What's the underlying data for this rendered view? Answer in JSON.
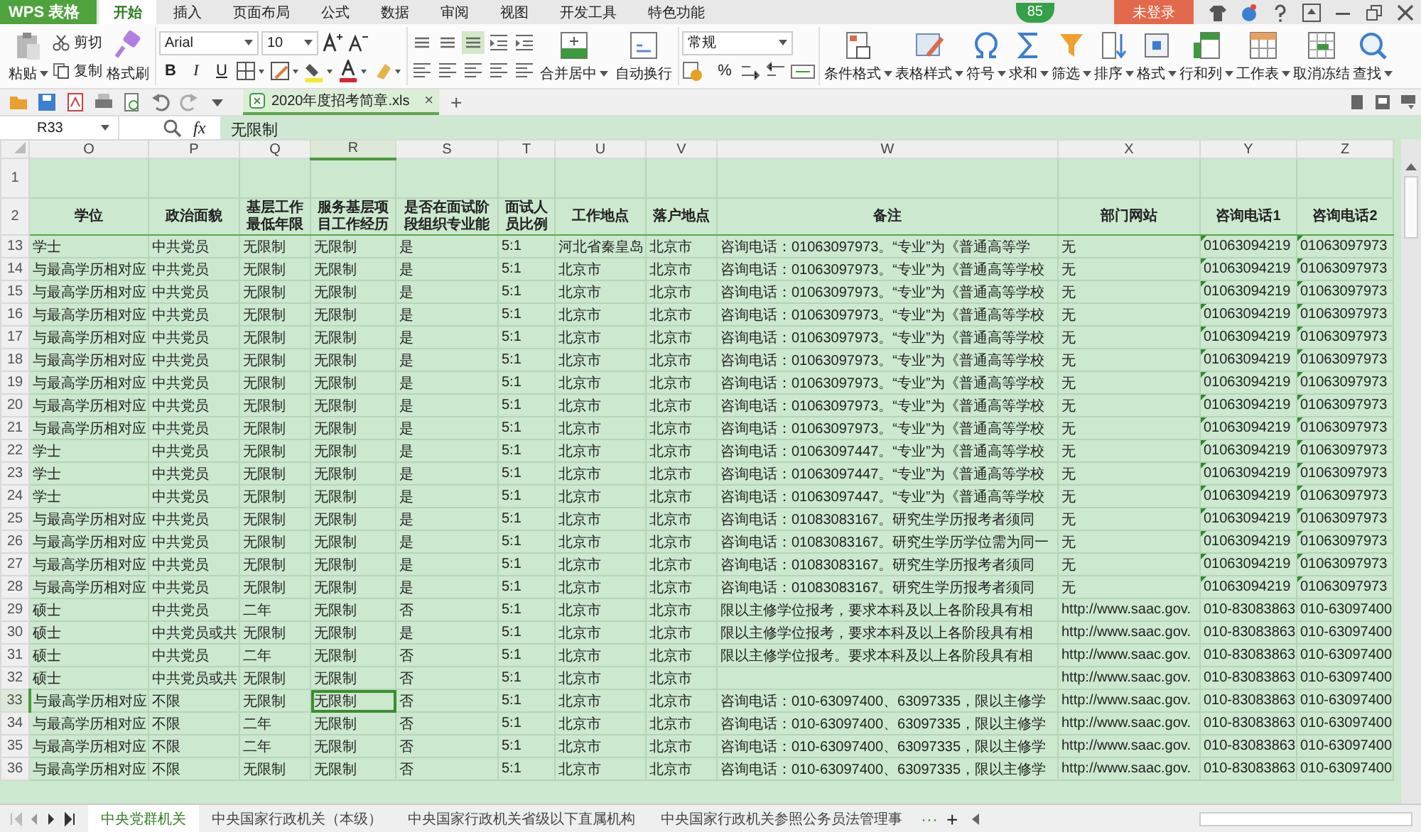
{
  "app": {
    "name": "WPS 表格",
    "badge": "85",
    "login": "未登录"
  },
  "menu_tabs": [
    {
      "label": "开始",
      "selected": true
    },
    {
      "label": "插入",
      "selected": false
    },
    {
      "label": "页面布局",
      "selected": false
    },
    {
      "label": "公式",
      "selected": false
    },
    {
      "label": "数据",
      "selected": false
    },
    {
      "label": "审阅",
      "selected": false
    },
    {
      "label": "视图",
      "selected": false
    },
    {
      "label": "开发工具",
      "selected": false
    },
    {
      "label": "特色功能",
      "selected": false
    }
  ],
  "ribbon": {
    "clipboard": {
      "paste": "粘贴",
      "cut": "剪切",
      "copy": "复制",
      "format_painter": "格式刷"
    },
    "font": {
      "name": "Arial",
      "size": "10",
      "bold": "B",
      "italic": "I",
      "underline": "U"
    },
    "alignment": {
      "merge": "合并居中",
      "wrap": "自动换行"
    },
    "number": {
      "format": "常规",
      "percent": "%"
    },
    "tools": [
      {
        "label": "条件格式",
        "kind": "conditional",
        "dropdown": true
      },
      {
        "label": "表格样式",
        "kind": "table-style",
        "dropdown": true
      },
      {
        "label": "符号",
        "kind": "symbol",
        "dropdown": true
      },
      {
        "label": "求和",
        "kind": "sum",
        "dropdown": true
      },
      {
        "label": "筛选",
        "kind": "filter",
        "dropdown": true
      },
      {
        "label": "排序",
        "kind": "sort",
        "dropdown": true
      },
      {
        "label": "格式",
        "kind": "format",
        "dropdown": true
      },
      {
        "label": "行和列",
        "kind": "rows-cols",
        "dropdown": true
      },
      {
        "label": "工作表",
        "kind": "sheet",
        "dropdown": true
      },
      {
        "label": "取消冻结",
        "kind": "freeze",
        "dropdown": false
      },
      {
        "label": "查找",
        "kind": "find",
        "dropdown": true
      }
    ]
  },
  "document_tab": {
    "title": "2020年度招考简章.xls",
    "close": "×",
    "add": "+"
  },
  "formula_bar": {
    "cell": "R33",
    "fx": "fx",
    "value": "无限制"
  },
  "columns": [
    {
      "letter": "O",
      "header": "学位",
      "selected": false
    },
    {
      "letter": "P",
      "header": "政治面貌",
      "selected": false
    },
    {
      "letter": "Q",
      "header": "基层工作最低年限",
      "selected": false
    },
    {
      "letter": "R",
      "header": "服务基层项目工作经历",
      "selected": true
    },
    {
      "letter": "S",
      "header": "是否在面试阶段组织专业能",
      "selected": false
    },
    {
      "letter": "T",
      "header": "面试人员比例",
      "selected": false
    },
    {
      "letter": "U",
      "header": "工作地点",
      "selected": false
    },
    {
      "letter": "V",
      "header": "落户地点",
      "selected": false
    },
    {
      "letter": "W",
      "header": "备注",
      "selected": false
    },
    {
      "letter": "X",
      "header": "部门网站",
      "selected": false
    },
    {
      "letter": "Y",
      "header": "咨询电话1",
      "selected": false
    },
    {
      "letter": "Z",
      "header": "咨询电话2",
      "selected": false
    }
  ],
  "top_rows": [
    "1",
    "2"
  ],
  "rows": [
    {
      "number": "13",
      "selected": false,
      "flagged": true,
      "cells": [
        "学士",
        "中共党员",
        "无限制",
        "无限制",
        "是",
        "5:1",
        "河北省秦皇岛",
        "北京市",
        "咨询电话：01063097973。“专业”为《普通高等学",
        "无",
        "01063094219",
        "01063097973"
      ]
    },
    {
      "number": "14",
      "selected": false,
      "flagged": true,
      "cells": [
        "与最高学历相对应",
        "中共党员",
        "无限制",
        "无限制",
        "是",
        "5:1",
        "北京市",
        "北京市",
        "咨询电话：01063097973。“专业”为《普通高等学校",
        "无",
        "01063094219",
        "01063097973"
      ]
    },
    {
      "number": "15",
      "selected": false,
      "flagged": true,
      "cells": [
        "与最高学历相对应",
        "中共党员",
        "无限制",
        "无限制",
        "是",
        "5:1",
        "北京市",
        "北京市",
        "咨询电话：01063097973。“专业”为《普通高等学校",
        "无",
        "01063094219",
        "01063097973"
      ]
    },
    {
      "number": "16",
      "selected": false,
      "flagged": true,
      "cells": [
        "与最高学历相对应",
        "中共党员",
        "无限制",
        "无限制",
        "是",
        "5:1",
        "北京市",
        "北京市",
        "咨询电话：01063097973。“专业”为《普通高等学校",
        "无",
        "01063094219",
        "01063097973"
      ]
    },
    {
      "number": "17",
      "selected": false,
      "flagged": true,
      "cells": [
        "与最高学历相对应",
        "中共党员",
        "无限制",
        "无限制",
        "是",
        "5:1",
        "北京市",
        "北京市",
        "咨询电话：01063097973。“专业”为《普通高等学校",
        "无",
        "01063094219",
        "01063097973"
      ]
    },
    {
      "number": "18",
      "selected": false,
      "flagged": true,
      "cells": [
        "与最高学历相对应",
        "中共党员",
        "无限制",
        "无限制",
        "是",
        "5:1",
        "北京市",
        "北京市",
        "咨询电话：01063097973。“专业”为《普通高等学校",
        "无",
        "01063094219",
        "01063097973"
      ]
    },
    {
      "number": "19",
      "selected": false,
      "flagged": true,
      "cells": [
        "与最高学历相对应",
        "中共党员",
        "无限制",
        "无限制",
        "是",
        "5:1",
        "北京市",
        "北京市",
        "咨询电话：01063097973。“专业”为《普通高等学校",
        "无",
        "01063094219",
        "01063097973"
      ]
    },
    {
      "number": "20",
      "selected": false,
      "flagged": true,
      "cells": [
        "与最高学历相对应",
        "中共党员",
        "无限制",
        "无限制",
        "是",
        "5:1",
        "北京市",
        "北京市",
        "咨询电话：01063097973。“专业”为《普通高等学校",
        "无",
        "01063094219",
        "01063097973"
      ]
    },
    {
      "number": "21",
      "selected": false,
      "flagged": true,
      "cells": [
        "与最高学历相对应",
        "中共党员",
        "无限制",
        "无限制",
        "是",
        "5:1",
        "北京市",
        "北京市",
        "咨询电话：01063097973。“专业”为《普通高等学校",
        "无",
        "01063094219",
        "01063097973"
      ]
    },
    {
      "number": "22",
      "selected": false,
      "flagged": true,
      "cells": [
        "学士",
        "中共党员",
        "无限制",
        "无限制",
        "是",
        "5:1",
        "北京市",
        "北京市",
        "咨询电话：01063097447。“专业”为《普通高等学校",
        "无",
        "01063094219",
        "01063097973"
      ]
    },
    {
      "number": "23",
      "selected": false,
      "flagged": true,
      "cells": [
        "学士",
        "中共党员",
        "无限制",
        "无限制",
        "是",
        "5:1",
        "北京市",
        "北京市",
        "咨询电话：01063097447。“专业”为《普通高等学校",
        "无",
        "01063094219",
        "01063097973"
      ]
    },
    {
      "number": "24",
      "selected": false,
      "flagged": true,
      "cells": [
        "学士",
        "中共党员",
        "无限制",
        "无限制",
        "是",
        "5:1",
        "北京市",
        "北京市",
        "咨询电话：01063097447。“专业”为《普通高等学校",
        "无",
        "01063094219",
        "01063097973"
      ]
    },
    {
      "number": "25",
      "selected": false,
      "flagged": true,
      "cells": [
        "与最高学历相对应",
        "中共党员",
        "无限制",
        "无限制",
        "是",
        "5:1",
        "北京市",
        "北京市",
        "咨询电话：01083083167。研究生学历报考者须同",
        "无",
        "01063094219",
        "01063097973"
      ]
    },
    {
      "number": "26",
      "selected": false,
      "flagged": true,
      "cells": [
        "与最高学历相对应",
        "中共党员",
        "无限制",
        "无限制",
        "是",
        "5:1",
        "北京市",
        "北京市",
        "咨询电话：01083083167。研究生学历学位需为同一",
        "无",
        "01063094219",
        "01063097973"
      ]
    },
    {
      "number": "27",
      "selected": false,
      "flagged": true,
      "cells": [
        "与最高学历相对应",
        "中共党员",
        "无限制",
        "无限制",
        "是",
        "5:1",
        "北京市",
        "北京市",
        "咨询电话：01083083167。研究生学历报考者须同",
        "无",
        "01063094219",
        "01063097973"
      ]
    },
    {
      "number": "28",
      "selected": false,
      "flagged": true,
      "cells": [
        "与最高学历相对应",
        "中共党员",
        "无限制",
        "无限制",
        "是",
        "5:1",
        "北京市",
        "北京市",
        "咨询电话：01083083167。研究生学历报考者须同",
        "无",
        "01063094219",
        "01063097973"
      ]
    },
    {
      "number": "29",
      "selected": false,
      "flagged": false,
      "cells": [
        "硕士",
        "中共党员",
        "二年",
        "无限制",
        "否",
        "5:1",
        "北京市",
        "北京市",
        "限以主修学位报考，要求本科及以上各阶段具有相",
        "http://www.saac.gov.",
        "010-83083863",
        "010-63097400"
      ]
    },
    {
      "number": "30",
      "selected": false,
      "flagged": false,
      "cells": [
        "硕士",
        "中共党员或共",
        "无限制",
        "无限制",
        "是",
        "5:1",
        "北京市",
        "北京市",
        "限以主修学位报考，要求本科及以上各阶段具有相",
        "http://www.saac.gov.",
        "010-83083863",
        "010-63097400"
      ]
    },
    {
      "number": "31",
      "selected": false,
      "flagged": false,
      "cells": [
        "硕士",
        "中共党员",
        "二年",
        "无限制",
        "否",
        "5:1",
        "北京市",
        "北京市",
        "限以主修学位报考。要求本科及以上各阶段具有相",
        "http://www.saac.gov.",
        "010-83083863",
        "010-63097400"
      ]
    },
    {
      "number": "32",
      "selected": false,
      "flagged": false,
      "cells": [
        "硕士",
        "中共党员或共",
        "无限制",
        "无限制",
        "否",
        "5:1",
        "北京市",
        "北京市",
        null,
        "http://www.saac.gov.",
        "010-83083863",
        "010-63097400"
      ]
    },
    {
      "number": "33",
      "selected": true,
      "flagged": false,
      "cells": [
        "与最高学历相对应",
        "不限",
        "无限制",
        "无限制",
        "否",
        "5:1",
        "北京市",
        "北京市",
        "咨询电话：010-63097400、63097335，限以主修学",
        "http://www.saac.gov.",
        "010-83083863",
        "010-63097400"
      ]
    },
    {
      "number": "34",
      "selected": false,
      "flagged": false,
      "cells": [
        "与最高学历相对应",
        "不限",
        "二年",
        "无限制",
        "否",
        "5:1",
        "北京市",
        "北京市",
        "咨询电话：010-63097400、63097335，限以主修学",
        "http://www.saac.gov.",
        "010-83083863",
        "010-63097400"
      ]
    },
    {
      "number": "35",
      "selected": false,
      "flagged": false,
      "cells": [
        "与最高学历相对应",
        "不限",
        "二年",
        "无限制",
        "否",
        "5:1",
        "北京市",
        "北京市",
        "咨询电话：010-63097400、63097335，限以主修学",
        "http://www.saac.gov.",
        "010-83083863",
        "010-63097400"
      ]
    },
    {
      "number": "36",
      "selected": false,
      "flagged": false,
      "cells": [
        "与最高学历相对应",
        "不限",
        "无限制",
        "无限制",
        "否",
        "5:1",
        "北京市",
        "北京市",
        "咨询电话：010-63097400、63097335，限以主修学",
        "http://www.saac.gov.",
        "010-83083863",
        "010-63097400"
      ]
    }
  ],
  "sheet_tabs": [
    {
      "label": "中央党群机关",
      "selected": true
    },
    {
      "label": "中央国家行政机关（本级）",
      "selected": false
    },
    {
      "label": "中央国家行政机关省级以下直属机构",
      "selected": false
    },
    {
      "label": "中央国家行政机关参照公务员法管理事",
      "selected": false
    }
  ],
  "sheet_more": "···",
  "sheet_add": "+"
}
